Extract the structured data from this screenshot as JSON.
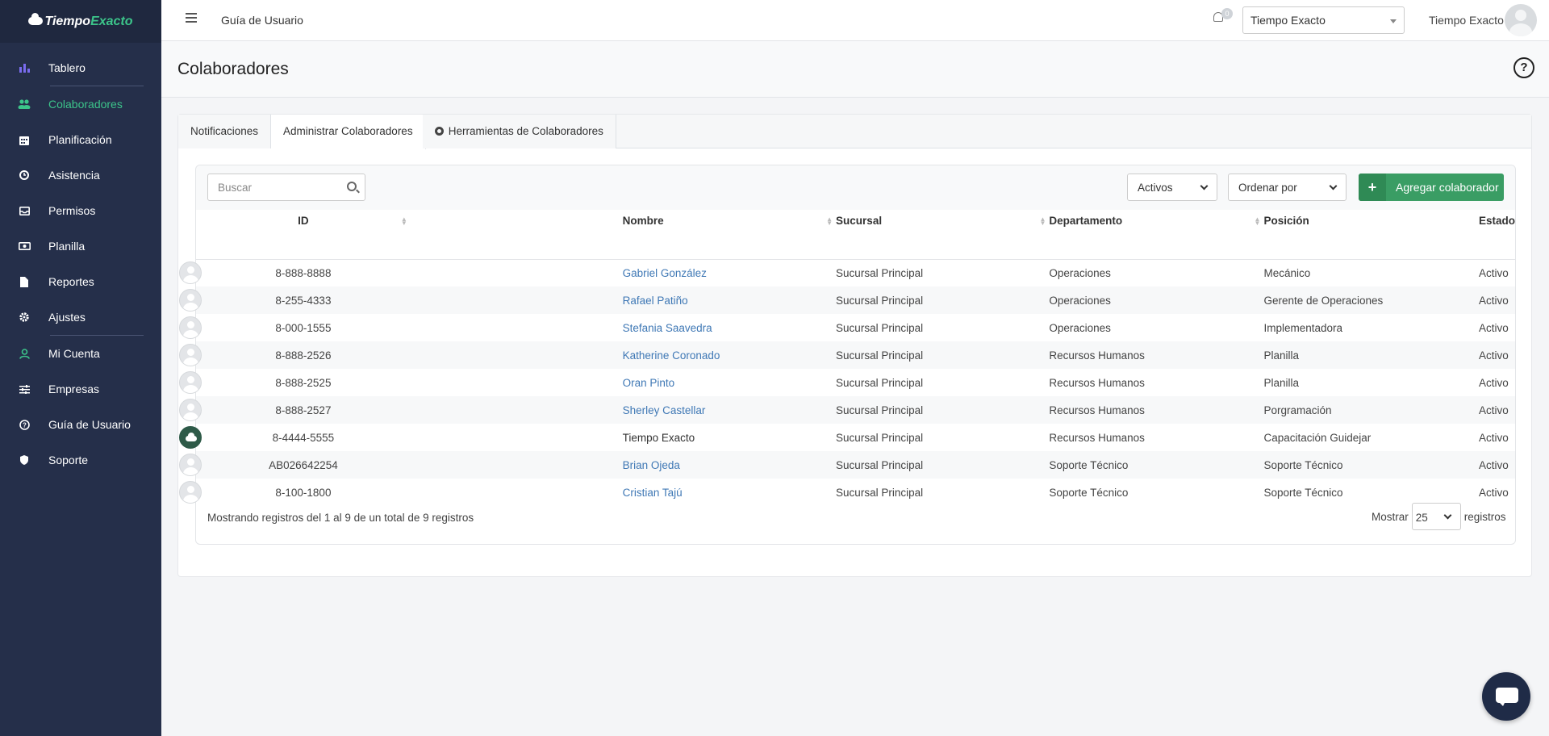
{
  "app": {
    "brand_part1": "Tiempo",
    "brand_part2": "Exacto",
    "accent_color": "#3cc48a",
    "sidebar_color": "#252f4a"
  },
  "sidebar": {
    "items": [
      {
        "label": "Tablero",
        "icon": "bar-chart-icon"
      },
      {
        "label": "Colaboradores",
        "icon": "users-icon",
        "active": true
      },
      {
        "label": "Planificación",
        "icon": "calendar-icon"
      },
      {
        "label": "Asistencia",
        "icon": "clock-icon"
      },
      {
        "label": "Permisos",
        "icon": "inbox-icon"
      },
      {
        "label": "Planilla",
        "icon": "money-icon"
      },
      {
        "label": "Reportes",
        "icon": "file-icon"
      },
      {
        "label": "Ajustes",
        "icon": "gear-icon"
      },
      {
        "label": "Mi Cuenta",
        "icon": "user-icon"
      },
      {
        "label": "Empresas",
        "icon": "sliders-icon"
      },
      {
        "label": "Guía de Usuario",
        "icon": "question-icon"
      },
      {
        "label": "Soporte",
        "icon": "shield-icon"
      }
    ]
  },
  "topbar": {
    "guide_link": "Guía de Usuario",
    "notification_count": "0",
    "company_selected": "Tiempo Exacto",
    "user_name": "Tiempo Exacto"
  },
  "page": {
    "title": "Colaboradores"
  },
  "tabs": [
    {
      "label": "Notificaciones"
    },
    {
      "label": "Administrar Colaboradores",
      "active": true
    },
    {
      "label": "Herramientas de Colaboradores"
    }
  ],
  "toolbar": {
    "search_placeholder": "Buscar",
    "status_filter": "Activos",
    "order_by": "Ordenar por",
    "add_button": "Agregar colaborador"
  },
  "table": {
    "columns": [
      "ID",
      "",
      "Nombre",
      "Sucursal",
      "Departamento",
      "Posición",
      "Estado"
    ],
    "rows": [
      {
        "id": "8-888-8888",
        "name": "Gabriel González",
        "branch": "Sucursal Principal",
        "department": "Operaciones",
        "position": "Mecánico",
        "status": "Activo",
        "link": true
      },
      {
        "id": "8-255-4333",
        "name": "Rafael Patiño",
        "branch": "Sucursal Principal",
        "department": "Operaciones",
        "position": "Gerente de Operaciones",
        "status": "Activo",
        "link": true
      },
      {
        "id": "8-000-1555",
        "name": "Stefania Saavedra",
        "branch": "Sucursal Principal",
        "department": "Operaciones",
        "position": "Implementadora",
        "status": "Activo",
        "link": true
      },
      {
        "id": "8-888-2526",
        "name": "Katherine Coronado",
        "branch": "Sucursal Principal",
        "department": "Recursos Humanos",
        "position": "Planilla",
        "status": "Activo",
        "link": true
      },
      {
        "id": "8-888-2525",
        "name": "Oran Pinto",
        "branch": "Sucursal Principal",
        "department": "Recursos Humanos",
        "position": "Planilla",
        "status": "Activo",
        "link": true
      },
      {
        "id": "8-888-2527",
        "name": "Sherley Castellar",
        "branch": "Sucursal Principal",
        "department": "Recursos Humanos",
        "position": "Porgramación",
        "status": "Activo",
        "link": true
      },
      {
        "id": "8-4444-5555",
        "name": "Tiempo Exacto",
        "branch": "Sucursal Principal",
        "department": "Recursos Humanos",
        "position": "Capacitación Guidejar",
        "status": "Activo",
        "link": false
      },
      {
        "id": "AB026642254",
        "name": "Brian Ojeda",
        "branch": "Sucursal Principal",
        "department": "Soporte Técnico",
        "position": "Soporte Técnico",
        "status": "Activo",
        "link": true
      },
      {
        "id": "8-100-1800",
        "name": "Cristian Tajú",
        "branch": "Sucursal Principal",
        "department": "Soporte Técnico",
        "position": "Soporte Técnico",
        "status": "Activo",
        "link": true
      }
    ]
  },
  "footer": {
    "info": "Mostrando registros del 1 al 9 de un total de 9 registros",
    "show_label": "Mostrar",
    "page_size": "25",
    "records_label": "registros"
  }
}
